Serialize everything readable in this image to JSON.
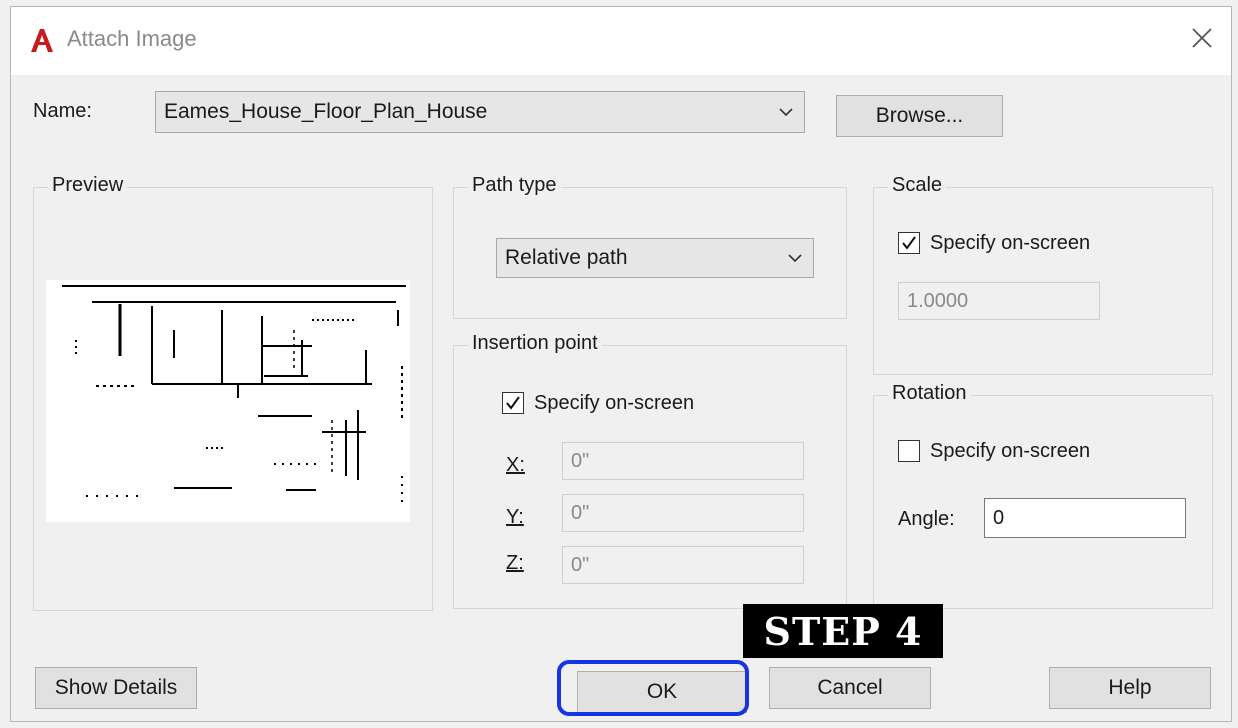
{
  "window": {
    "title": "Attach Image"
  },
  "name_row": {
    "label": "Name:",
    "value": "Eames_House_Floor_Plan_House",
    "browse_label": "Browse..."
  },
  "preview": {
    "title": "Preview"
  },
  "path_type": {
    "title": "Path type",
    "value": "Relative path"
  },
  "insertion_point": {
    "title": "Insertion point",
    "specify_label": "Specify on-screen",
    "specify_checked": true,
    "x_label": "X:",
    "x_value": "0\"",
    "y_label": "Y:",
    "y_value": "0\"",
    "z_label": "Z:",
    "z_value": "0\""
  },
  "scale": {
    "title": "Scale",
    "specify_label": "Specify on-screen",
    "specify_checked": true,
    "value": "1.0000"
  },
  "rotation": {
    "title": "Rotation",
    "specify_label": "Specify on-screen",
    "specify_checked": false,
    "angle_label": "Angle:",
    "angle_value": "0"
  },
  "buttons": {
    "show_details": "Show Details",
    "ok": "OK",
    "cancel": "Cancel",
    "help": "Help"
  },
  "annotation": {
    "step": "STEP 4"
  },
  "colors": {
    "highlight": "#1534e6",
    "app_icon": "#c8191f"
  }
}
